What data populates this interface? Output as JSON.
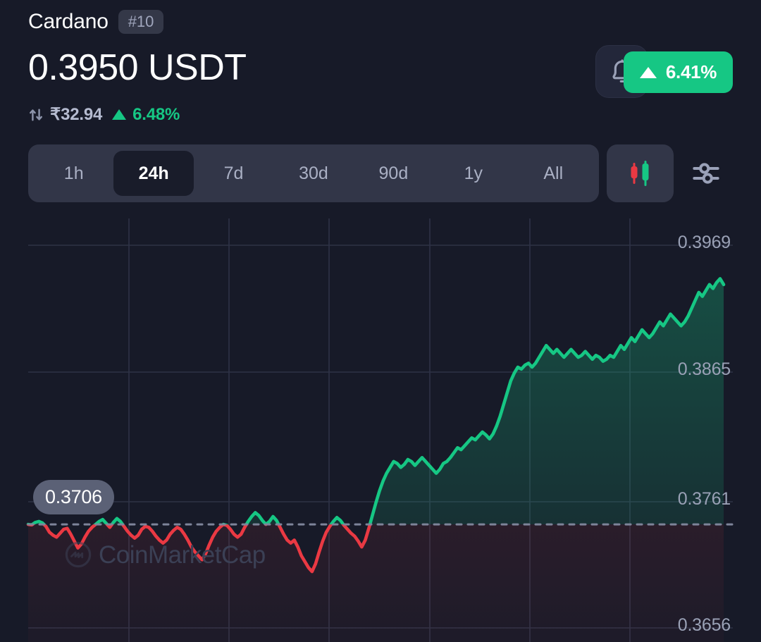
{
  "header": {
    "coin_name": "Cardano",
    "rank_badge": "#10",
    "price": "0.3950 USDT",
    "fiat_price": "₹32.94",
    "fiat_change": "6.48%",
    "swap_icon": "swap-arrows-icon",
    "alert_icon": "bell-icon",
    "badge_change": "6.41%",
    "badge_direction": "up",
    "accent_green": "#16c784",
    "accent_red": "#ea3943"
  },
  "timeframes": {
    "tabs": [
      {
        "label": "1h",
        "active": false
      },
      {
        "label": "24h",
        "active": true
      },
      {
        "label": "7d",
        "active": false
      },
      {
        "label": "30d",
        "active": false
      },
      {
        "label": "90d",
        "active": false
      },
      {
        "label": "1y",
        "active": false
      },
      {
        "label": "All",
        "active": false
      }
    ],
    "candlestick_icon": "candlestick-chart-icon",
    "settings_icon": "sliders-settings-icon"
  },
  "chart_data": {
    "type": "area",
    "title": "Cardano 24h price",
    "xlabel": "",
    "ylabel": "USDT",
    "grid": true,
    "legend": false,
    "watermark": "CoinMarketCap",
    "y_tick_labels": [
      "0.3969",
      "0.3865",
      "0.3761",
      "0.3656"
    ],
    "ylim": [
      0.361,
      0.399
    ],
    "reference_line": {
      "value": "0.3706",
      "label": "0.3706",
      "style": "dashed"
    },
    "line_color_up": "#16c784",
    "line_color_down": "#ea3943",
    "x": [
      0,
      1,
      2,
      3,
      4,
      5,
      6,
      7,
      8,
      9,
      10,
      11,
      12,
      13,
      14,
      15,
      16,
      17,
      18,
      19,
      20,
      21,
      22,
      23,
      24,
      25,
      26,
      27,
      28,
      29,
      30,
      31,
      32,
      33,
      34,
      35,
      36,
      37,
      38,
      39,
      40,
      41,
      42,
      43,
      44,
      45,
      46,
      47,
      48,
      49,
      50,
      51,
      52,
      53,
      54,
      55,
      56,
      57,
      58,
      59,
      60,
      61,
      62,
      63,
      64,
      65,
      66,
      67,
      68,
      69,
      70,
      71,
      72,
      73,
      74,
      75,
      76,
      77,
      78,
      79,
      80,
      81,
      82,
      83,
      84,
      85,
      86,
      87,
      88,
      89,
      90,
      91,
      92,
      93,
      94,
      95,
      96,
      97,
      98,
      99,
      100,
      101,
      102,
      103,
      104,
      105,
      106,
      107,
      108,
      109,
      110,
      111,
      112,
      113,
      114,
      115,
      116,
      117,
      118,
      119,
      120,
      121,
      122,
      123,
      124,
      125,
      126,
      127,
      128,
      129,
      130,
      131,
      132,
      133,
      134,
      135,
      136,
      137,
      138,
      139,
      140,
      141,
      142,
      143,
      144,
      145,
      146,
      147,
      148,
      149,
      150,
      151,
      152,
      153,
      154,
      155,
      156,
      157,
      158,
      159,
      160,
      161,
      162,
      163,
      164,
      165,
      166,
      167,
      168,
      169,
      170,
      171,
      172,
      173,
      174,
      175,
      176,
      177,
      178,
      179,
      180,
      181,
      182,
      183,
      184,
      185,
      186,
      187,
      188,
      189,
      190,
      191,
      192,
      193,
      194,
      195,
      196,
      197
    ],
    "values": [
      0.3706,
      0.37055,
      0.3708,
      0.3709,
      0.37075,
      0.3704,
      0.3698,
      0.3695,
      0.3693,
      0.3697,
      0.3701,
      0.3702,
      0.3696,
      0.3689,
      0.3682,
      0.3686,
      0.3693,
      0.3699,
      0.3703,
      0.3706,
      0.3709,
      0.3711,
      0.3707,
      0.3703,
      0.3708,
      0.3712,
      0.3709,
      0.3704,
      0.3699,
      0.3695,
      0.3692,
      0.3695,
      0.3701,
      0.3704,
      0.3703,
      0.3699,
      0.3694,
      0.369,
      0.3687,
      0.369,
      0.3696,
      0.37,
      0.3703,
      0.3701,
      0.3696,
      0.369,
      0.3683,
      0.3678,
      0.3674,
      0.367,
      0.3676,
      0.3685,
      0.3693,
      0.3699,
      0.3703,
      0.3706,
      0.3705,
      0.3701,
      0.3696,
      0.3693,
      0.3696,
      0.3703,
      0.3709,
      0.3714,
      0.3718,
      0.3715,
      0.371,
      0.3706,
      0.3709,
      0.3714,
      0.371,
      0.3703,
      0.3696,
      0.369,
      0.3687,
      0.369,
      0.3683,
      0.3674,
      0.3668,
      0.3662,
      0.3658,
      0.3666,
      0.3678,
      0.3689,
      0.3698,
      0.3704,
      0.3709,
      0.3713,
      0.371,
      0.3705,
      0.3701,
      0.3697,
      0.3694,
      0.3689,
      0.3683,
      0.369,
      0.3702,
      0.3715,
      0.3728,
      0.374,
      0.375,
      0.3758,
      0.3764,
      0.377,
      0.3768,
      0.3764,
      0.3767,
      0.3772,
      0.377,
      0.3766,
      0.377,
      0.3774,
      0.377,
      0.3766,
      0.3762,
      0.3758,
      0.3762,
      0.3768,
      0.377,
      0.3774,
      0.3779,
      0.3784,
      0.3782,
      0.3786,
      0.379,
      0.3794,
      0.3792,
      0.3796,
      0.38,
      0.3797,
      0.3793,
      0.3798,
      0.3806,
      0.3816,
      0.3828,
      0.384,
      0.3852,
      0.386,
      0.3866,
      0.3864,
      0.3868,
      0.387,
      0.3866,
      0.387,
      0.3876,
      0.3882,
      0.3888,
      0.3884,
      0.388,
      0.3884,
      0.388,
      0.3876,
      0.388,
      0.3884,
      0.388,
      0.3876,
      0.3878,
      0.3882,
      0.3878,
      0.3874,
      0.3878,
      0.3876,
      0.3872,
      0.3874,
      0.3878,
      0.3876,
      0.3882,
      0.3888,
      0.3884,
      0.389,
      0.3896,
      0.3892,
      0.3898,
      0.3904,
      0.39,
      0.3896,
      0.39,
      0.3906,
      0.3912,
      0.3908,
      0.3914,
      0.392,
      0.3916,
      0.3912,
      0.3908,
      0.3912,
      0.3918,
      0.3926,
      0.3934,
      0.3942,
      0.3938,
      0.3944,
      0.395,
      0.3946,
      0.3952,
      0.3956,
      0.395
    ]
  }
}
